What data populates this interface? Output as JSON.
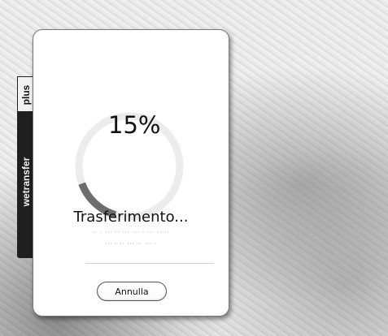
{
  "side_tab": {
    "brand": "wetransfer",
    "plus": "plus"
  },
  "transfer": {
    "percent_label": "15%",
    "progress": 0.15,
    "status": "Trasferimento...",
    "cancel_label": "Annulla"
  },
  "colors": {
    "progress_arc": "#6d6d6d",
    "progress_track": "#ececec"
  }
}
